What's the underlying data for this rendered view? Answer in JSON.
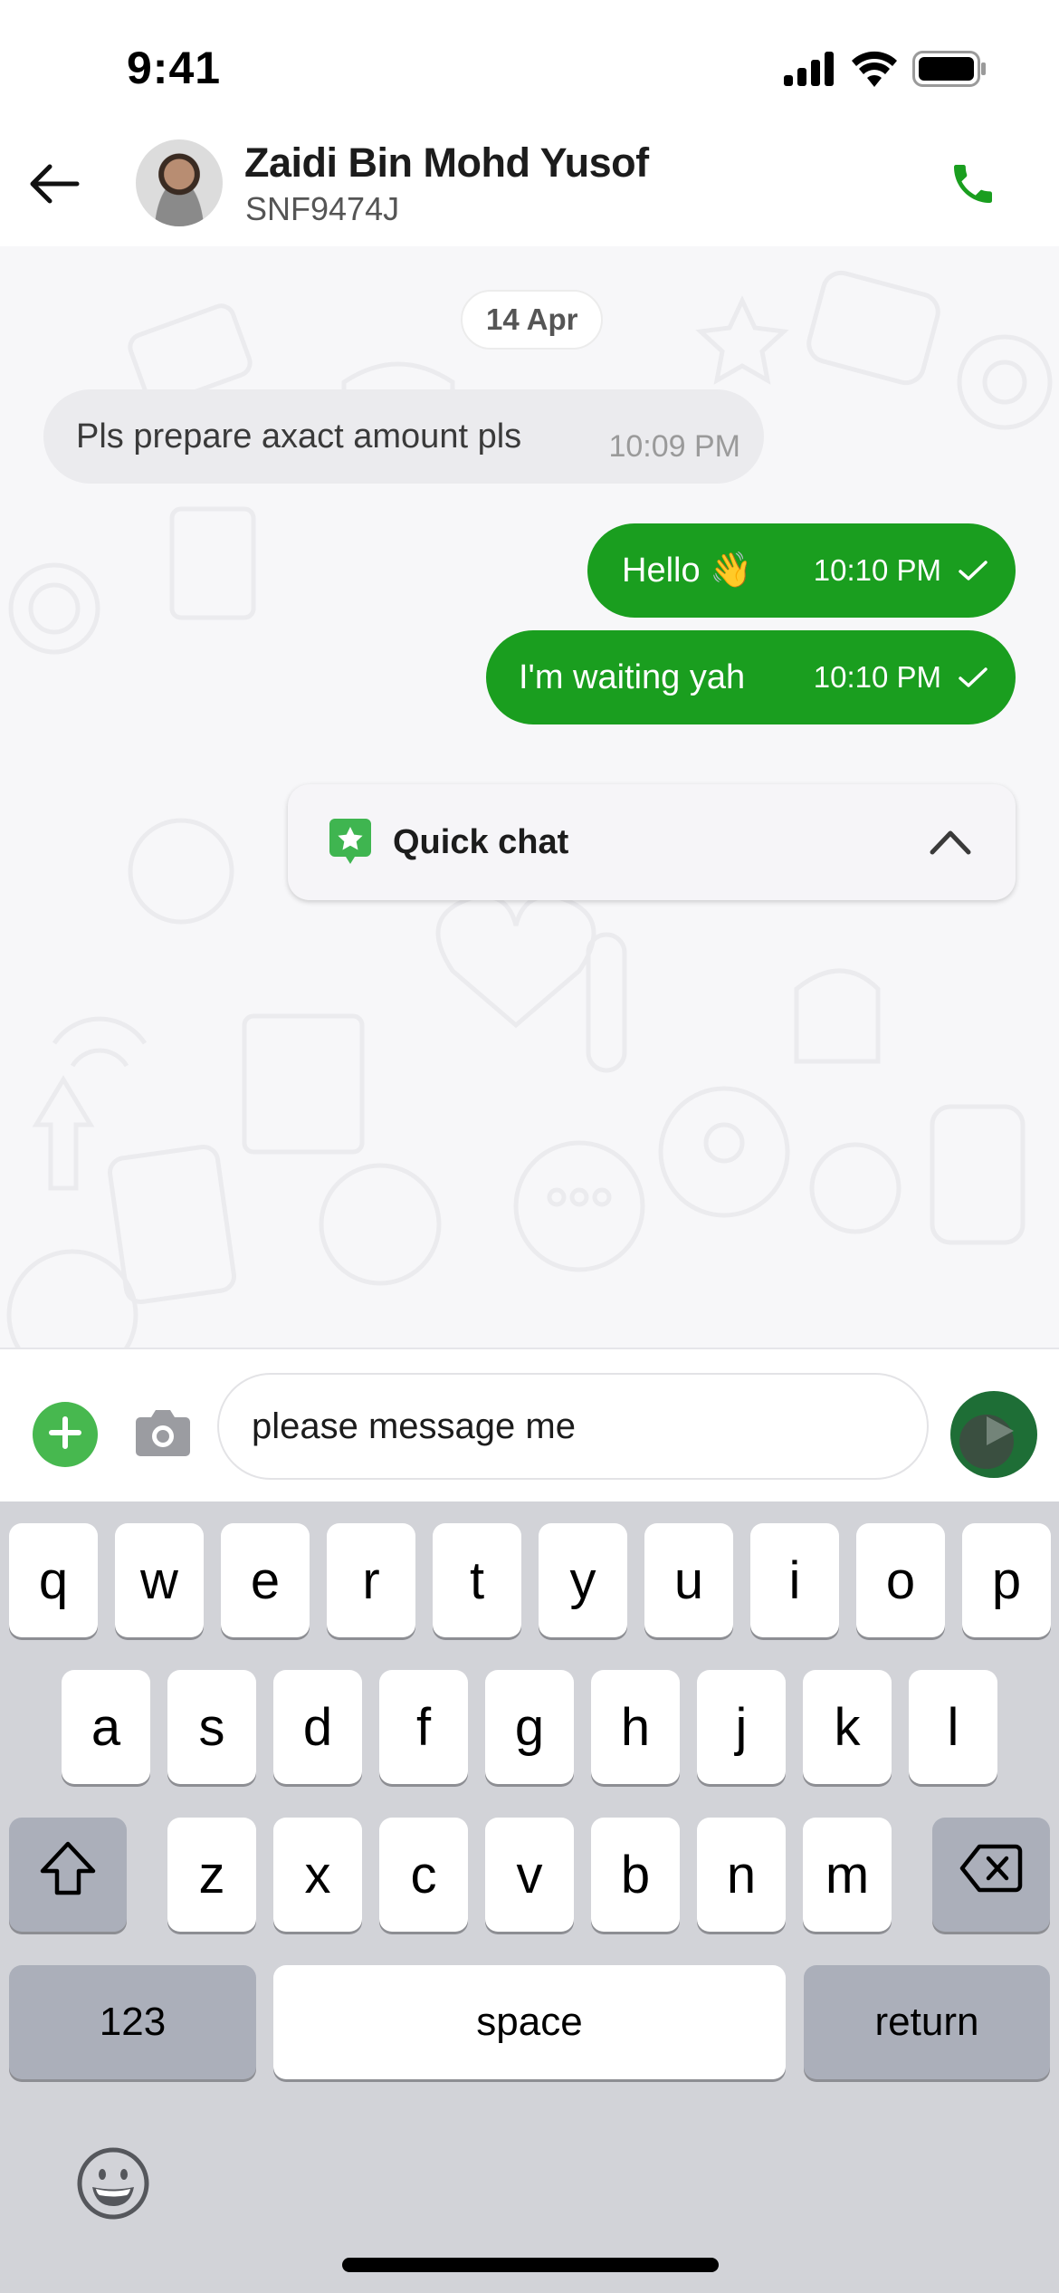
{
  "status_bar": {
    "time": "9:41",
    "icons": [
      "cellular-signal-icon",
      "wifi-icon",
      "battery-icon"
    ]
  },
  "header": {
    "back_icon": "arrow-left-icon",
    "contact_name": "Zaidi Bin Mohd Yusof",
    "contact_subtitle": "SNF9474J",
    "call_icon": "phone-icon",
    "accent_color": "#1a9e1f"
  },
  "chat": {
    "date_separator": "14 Apr",
    "messages": [
      {
        "direction": "incoming",
        "text": "Pls prepare axact amount pls",
        "time": "10:09 PM"
      },
      {
        "direction": "outgoing",
        "text": "Hello 👋",
        "time": "10:10 PM",
        "status": "sent"
      },
      {
        "direction": "outgoing",
        "text": "I'm waiting yah",
        "time": "10:10 PM",
        "status": "sent"
      }
    ],
    "quick_chat": {
      "label": "Quick chat",
      "icon": "star-chat-bubble-icon",
      "expanded": false,
      "toggle_icon": "chevron-up-icon"
    }
  },
  "composer": {
    "add_icon": "plus-icon",
    "camera_icon": "camera-icon",
    "input_value": "please message me",
    "send_icon": "send-icon"
  },
  "keyboard": {
    "row1": [
      "q",
      "w",
      "e",
      "r",
      "t",
      "y",
      "u",
      "i",
      "o",
      "p"
    ],
    "row2": [
      "a",
      "s",
      "d",
      "f",
      "g",
      "h",
      "j",
      "k",
      "l"
    ],
    "row3": [
      "z",
      "x",
      "c",
      "v",
      "b",
      "n",
      "m"
    ],
    "shift_icon": "shift-icon",
    "delete_icon": "delete-backward-icon",
    "numbers_label": "123",
    "space_label": "space",
    "return_label": "return",
    "emoji_icon": "emoji-icon"
  }
}
